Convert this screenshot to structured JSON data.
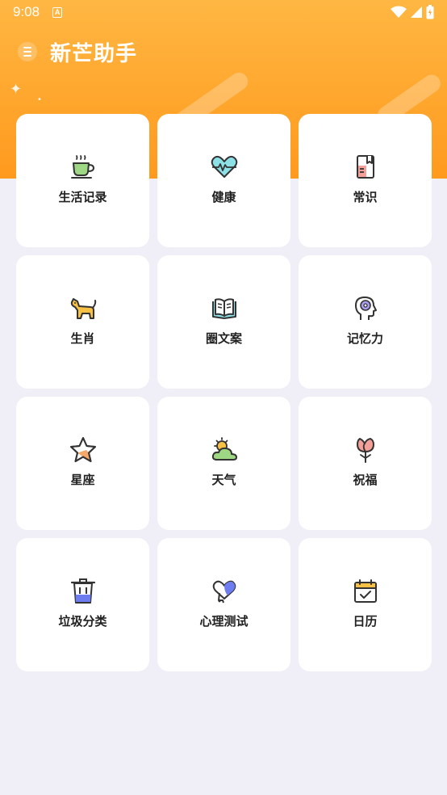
{
  "status_bar": {
    "time": "9:08",
    "notification_glyph": "A"
  },
  "app_bar": {
    "title": "新芒助手"
  },
  "colors": {
    "header_top": "#ffb743",
    "header_bottom": "#ff9a1e",
    "page_bg": "#f0eff8",
    "card_bg": "#ffffff"
  },
  "cards": [
    {
      "label": "生活记录",
      "icon": "tea-cup-icon"
    },
    {
      "label": "健康",
      "icon": "heart-pulse-icon"
    },
    {
      "label": "常识",
      "icon": "book-bookmark-icon"
    },
    {
      "label": "生肖",
      "icon": "dog-icon"
    },
    {
      "label": "圈文案",
      "icon": "open-book-icon"
    },
    {
      "label": "记忆力",
      "icon": "brain-head-icon"
    },
    {
      "label": "星座",
      "icon": "star-icon"
    },
    {
      "label": "天气",
      "icon": "sun-cloud-icon"
    },
    {
      "label": "祝福",
      "icon": "tulip-icon"
    },
    {
      "label": "垃圾分类",
      "icon": "trash-bin-icon"
    },
    {
      "label": "心理测试",
      "icon": "heart-head-icon"
    },
    {
      "label": "日历",
      "icon": "calendar-check-icon"
    }
  ]
}
